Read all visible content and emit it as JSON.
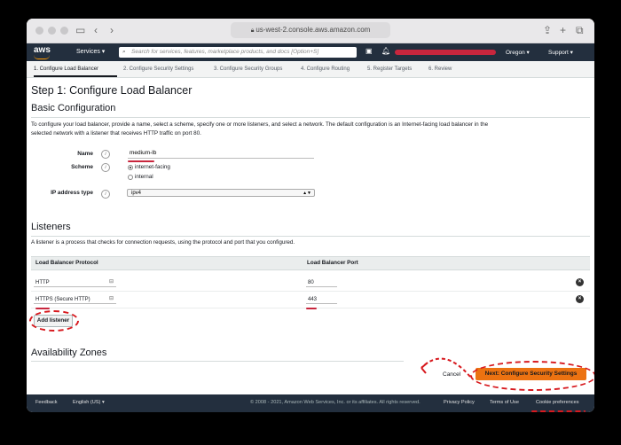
{
  "browser": {
    "url": "us-west-2.console.aws.amazon.com"
  },
  "nav": {
    "logo": "aws",
    "services": "Services",
    "search_placeholder": "Search for services, features, marketplace products, and docs [Option+S]",
    "region": "Oregon",
    "support": "Support"
  },
  "steps": [
    "1. Configure Load Balancer",
    "2. Configure Security Settings",
    "3. Configure Security Groups",
    "4. Configure Routing",
    "5. Register Targets",
    "6. Review"
  ],
  "page": {
    "title": "Step 1: Configure Load Balancer",
    "basic_heading": "Basic Configuration",
    "basic_desc_1": "To configure your load balancer, provide a name, select a scheme, specify one or more listeners, and select a network. The default configuration is an Internet-facing load balancer in the",
    "basic_desc_2": "selected network with a listener that receives HTTP traffic on port 80."
  },
  "form": {
    "name_label": "Name",
    "name_value": "medium-lb",
    "scheme_label": "Scheme",
    "scheme_options": [
      "internet-facing",
      "internal"
    ],
    "scheme_selected": "internet-facing",
    "ip_label": "IP address type",
    "ip_value": "ipv4",
    "info_glyph": "i"
  },
  "listeners": {
    "heading": "Listeners",
    "desc": "A listener is a process that checks for connection requests, using the protocol and port that you configured.",
    "col_protocol": "Load Balancer Protocol",
    "col_port": "Load Balancer Port",
    "rows": [
      {
        "protocol": "HTTP",
        "port": "80"
      },
      {
        "protocol": "HTTPS (Secure HTTP)",
        "port": "443"
      }
    ],
    "add_button": "Add listener"
  },
  "availability": {
    "heading": "Availability Zones"
  },
  "actions": {
    "cancel": "Cancel",
    "next": "Next: Configure Security Settings"
  },
  "footer": {
    "feedback": "Feedback",
    "language": "English (US)",
    "copyright": "© 2008 - 2021, Amazon Web Services, Inc. or its affiliates. All rights reserved.",
    "privacy": "Privacy Policy",
    "terms": "Terms of Use",
    "cookies": "Cookie preferences"
  },
  "colors": {
    "nav_bg": "#232f3e",
    "primary_button": "#ec7211",
    "annotation": "#d7191e"
  }
}
